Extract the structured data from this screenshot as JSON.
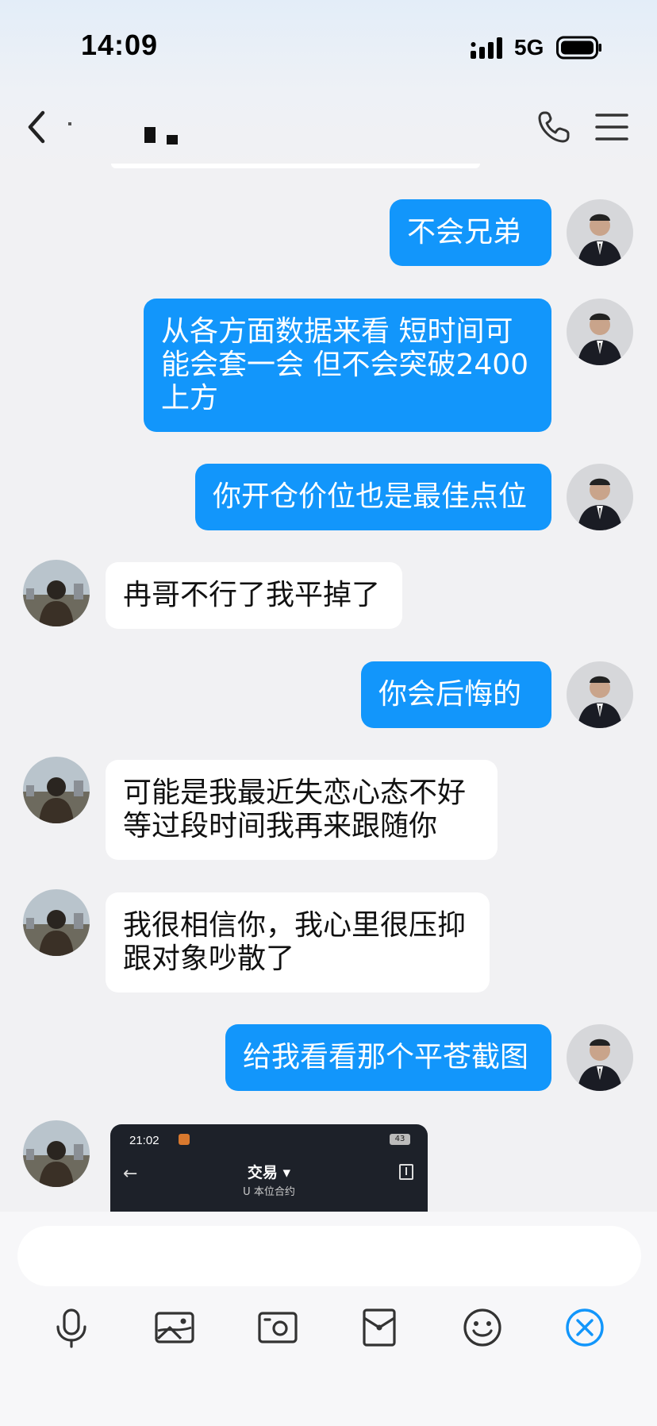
{
  "status_bar": {
    "time": "14:09",
    "network": "5G"
  },
  "header": {
    "contact_name": "· ▘▖"
  },
  "colors": {
    "outgoing_bubble": "#1296fb",
    "incoming_bubble": "#ffffff",
    "background": "#f1f1f3",
    "close_accent": "#1296fb"
  },
  "messages": [
    {
      "direction": "out",
      "text": "不会兄弟"
    },
    {
      "direction": "out",
      "text": "从各方面数据来看 短时间可\n能会套一会 但不会突破2400\n上方"
    },
    {
      "direction": "out",
      "text": "你开仓价位也是最佳点位"
    },
    {
      "direction": "in",
      "text": "冉哥不行了我平掉了"
    },
    {
      "direction": "out",
      "text": "你会后悔的"
    },
    {
      "direction": "in",
      "text": "可能是我最近失恋心态不好\n等过段时间我再来跟随你"
    },
    {
      "direction": "in",
      "text": "我很相信你，我心里很压抑\n跟对象吵散了"
    },
    {
      "direction": "out",
      "text": "给我看看那个平苍截图"
    }
  ],
  "image_message": {
    "time": "21:02",
    "battery": "43",
    "title": "交易 ▾",
    "subtitle": "U 本位合约"
  },
  "input": {
    "value": "",
    "placeholder": ""
  },
  "toolbar": {
    "icons": [
      "microphone-icon",
      "image-icon",
      "camera-icon",
      "red-packet-icon",
      "emoji-icon",
      "close-icon"
    ]
  }
}
